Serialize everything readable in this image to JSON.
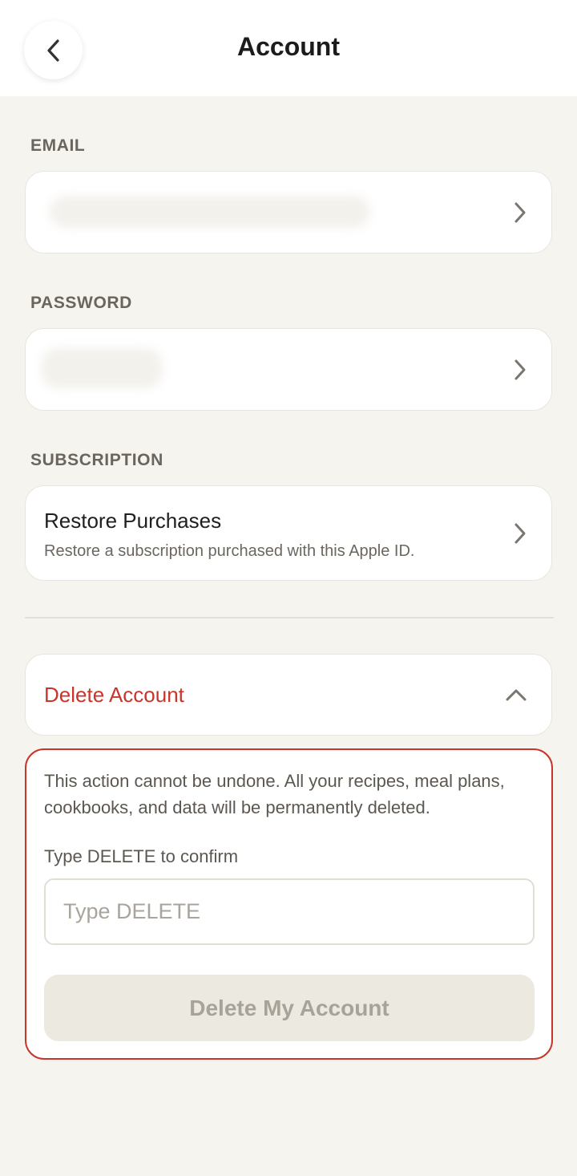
{
  "header": {
    "title": "Account"
  },
  "sections": {
    "email_label": "EMAIL",
    "password_label": "PASSWORD",
    "subscription_label": "SUBSCRIPTION"
  },
  "subscription": {
    "restore_title": "Restore Purchases",
    "restore_subtitle": "Restore a subscription purchased with this Apple ID."
  },
  "delete": {
    "toggle_label": "Delete Account",
    "warning": "This action cannot be undone. All your recipes, meal plans, cookbooks, and data will be permanently deleted.",
    "confirm_label": "Type DELETE to confirm",
    "input_placeholder": "Type DELETE",
    "input_value": "",
    "button_label": "Delete My Account"
  },
  "icons": {
    "back": "chevron-left-icon",
    "row": "chevron-right-icon",
    "collapse": "chevron-up-icon"
  },
  "colors": {
    "background": "#f6f4ef",
    "danger": "#c8352a",
    "disabled_button": "#ece9e1"
  }
}
